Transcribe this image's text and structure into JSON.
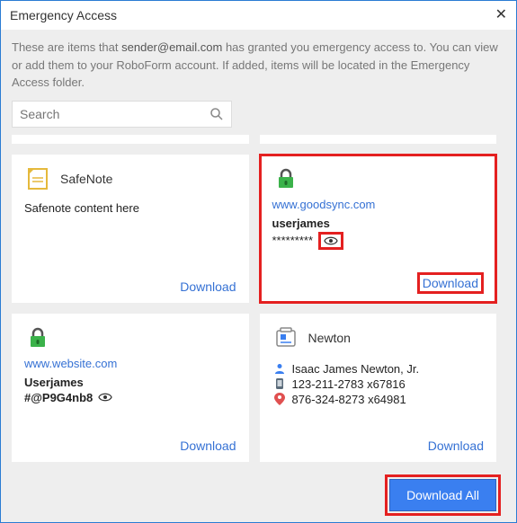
{
  "window": {
    "title": "Emergency Access"
  },
  "description": {
    "pre": "These are items that ",
    "email": "sender@email.com",
    "post": " has granted you emergency access to. You can view or add them to your RoboForm account. If added, items will be located in the Emergency Access folder."
  },
  "search": {
    "placeholder": "Search"
  },
  "labels": {
    "download": "Download",
    "download_all": "Download All"
  },
  "cards": {
    "safenote": {
      "title": "SafeNote",
      "content": "Safenote content here"
    },
    "goodsync": {
      "url": "www.goodsync.com",
      "username": "userjames",
      "password": "*********"
    },
    "website": {
      "url": "www.website.com",
      "username": "Userjames",
      "password": "#@P9G4nb8"
    },
    "newton": {
      "title": "Newton",
      "name": "Isaac James Newton, Jr.",
      "phone1": "123-211-2783 x67816",
      "phone2": "876-324-8273 x64981"
    }
  }
}
